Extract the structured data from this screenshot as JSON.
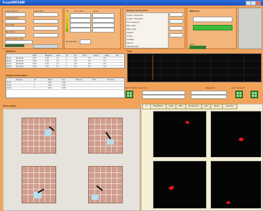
{
  "window": {
    "title": "F.vuoVMTLNM"
  },
  "params": {
    "labels": [
      "Project Name",
      "Sample Name",
      "Save Path",
      "Rep Frame",
      "Measurement Time"
    ],
    "col2_label": "Calibration"
  },
  "ch_panel": {
    "header1": "Ch",
    "header2": "Ex Ln Nm",
    "header3": "Gain",
    "bottom_label": "No.Sampler"
  },
  "analysis": {
    "title": "Analysis Parameters",
    "rows": [
      "Upper Threshold",
      "Lower Threshold",
      "Fluorescence",
      "Min Area",
      "Max Area",
      "Object",
      "Scale",
      "Scatter",
      "Kernel",
      "Wavelength"
    ]
  },
  "monitor": {
    "title": "MBVueus",
    "bottom": "Save"
  },
  "statistics": {
    "title": "Statistics",
    "headers": [
      "",
      "Start",
      "Elapsed",
      "Area",
      "Ct",
      "Ch",
      "Fluor",
      "Perim",
      "Mean",
      "Std"
    ],
    "rows": [
      [
        "Row1",
        "00:02:00",
        "0:00",
        "1.00",
        "1.0",
        "1",
        "0.0",
        "0.0",
        "0.0",
        ""
      ],
      [
        "Row2",
        "00:02:00",
        "0:00",
        "1.00",
        "1.0",
        "1",
        "0.0",
        "0.0",
        "0.0",
        ""
      ],
      [
        "Row3",
        "00:02:00",
        "0:00",
        "1.00",
        "1.0",
        "1",
        "0.0",
        "0.0",
        "0.0",
        ""
      ],
      [
        "Row4",
        "00:02:00",
        "0:00",
        "1.00",
        "1.0",
        "1",
        "0.0",
        "0.0",
        "0.0",
        ""
      ]
    ]
  },
  "sample_info": {
    "title": "Sample information",
    "headers": [
      "",
      "Sample",
      "Ch",
      "Start",
      "End",
      "Interval",
      "Fold",
      "Process"
    ],
    "rows": [
      [
        "Row1",
        "",
        "1",
        "0.00",
        "0.00",
        "",
        "",
        ""
      ],
      [
        "Row2",
        "",
        "1",
        "0.00",
        "0.00",
        "",
        "",
        ""
      ],
      [
        "Row3",
        "",
        "1",
        "0.00",
        "0.00",
        "",
        "",
        ""
      ]
    ]
  },
  "time": {
    "title": "Time"
  },
  "nav": {
    "left_label": "Set XY Motion  Last Loc",
    "mid_label": "Stage Pos",
    "right_label": "Auto Focus  AF"
  },
  "views": {
    "left_title": "Phase Views",
    "tabs": [
      "All",
      "Brightfield",
      "DAPI",
      "FITC",
      "Rhodamine",
      "Cy5",
      "Texas",
      "Overlay"
    ]
  },
  "colors": {
    "accent": "#f2a35a",
    "titlebar": "#1a4fb8",
    "status_green": "#3bbd3b",
    "blob_red": "#e01818"
  }
}
